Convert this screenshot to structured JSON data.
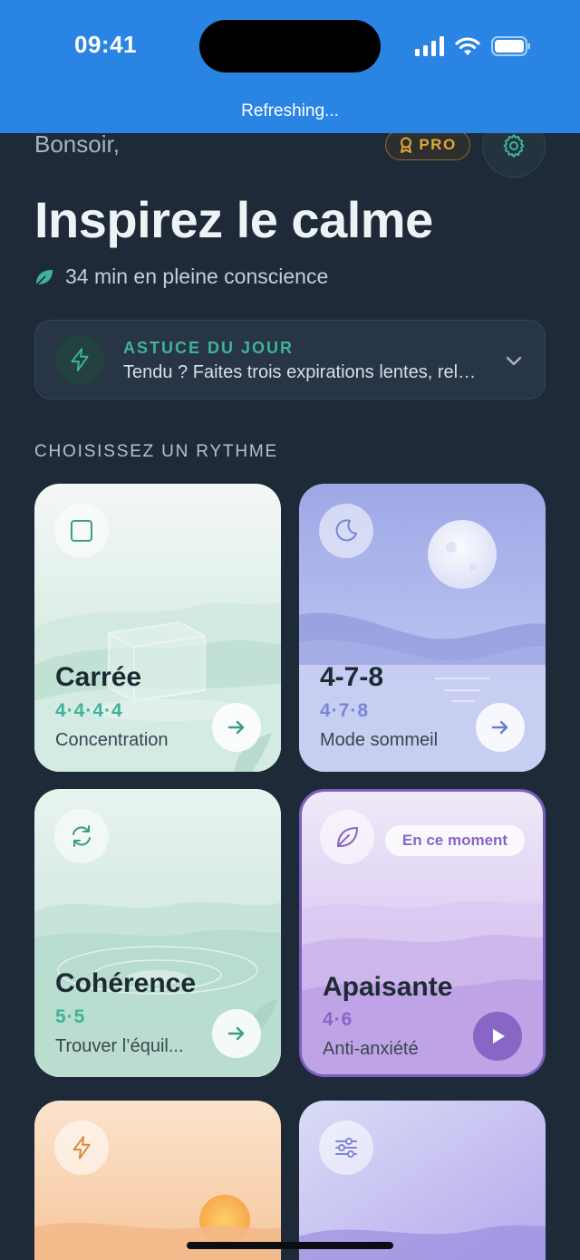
{
  "status_bar": {
    "time": "09:41",
    "refresh_text": "Refreshing..."
  },
  "header": {
    "greeting": "Bonsoir,",
    "pro_label": "PRO",
    "title": "Inspirez le calme",
    "minutes_text": "34 min en pleine conscience"
  },
  "tip": {
    "title": "ASTUCE DU JOUR",
    "text": "Tendu ? Faites trois expirations lentes, relâchez les épaules."
  },
  "section": {
    "label": "CHOISISSEZ UN RYTHME"
  },
  "rhythms": [
    {
      "title": "Carrée",
      "pattern": "4·4·4·4",
      "subtitle": "Concentration",
      "icon": "square-icon",
      "action": "arrow-right-icon"
    },
    {
      "title": "4-7-8",
      "pattern": "4·7·8",
      "subtitle": "Mode sommeil",
      "icon": "moon-icon",
      "action": "arrow-right-icon"
    },
    {
      "title": "Cohérence",
      "pattern": "5·5",
      "subtitle": "Trouver l’équil...",
      "icon": "refresh-icon",
      "action": "arrow-right-icon"
    },
    {
      "title": "Apaisante",
      "pattern": "4·6",
      "subtitle": "Anti-anxiété",
      "badge": "En ce moment",
      "icon": "leaf-icon",
      "action": "play-icon"
    },
    {
      "title": "",
      "pattern": "",
      "subtitle": "",
      "icon": "lightning-icon"
    },
    {
      "title": "",
      "pattern": "",
      "subtitle": "",
      "icon": "sliders-icon"
    }
  ],
  "colors": {
    "status_bar": "#2a84e4",
    "background": "#1f2a38",
    "accent_green": "#3fb39a",
    "pro_gold": "#e0a834",
    "lavender": "#8866c6"
  }
}
